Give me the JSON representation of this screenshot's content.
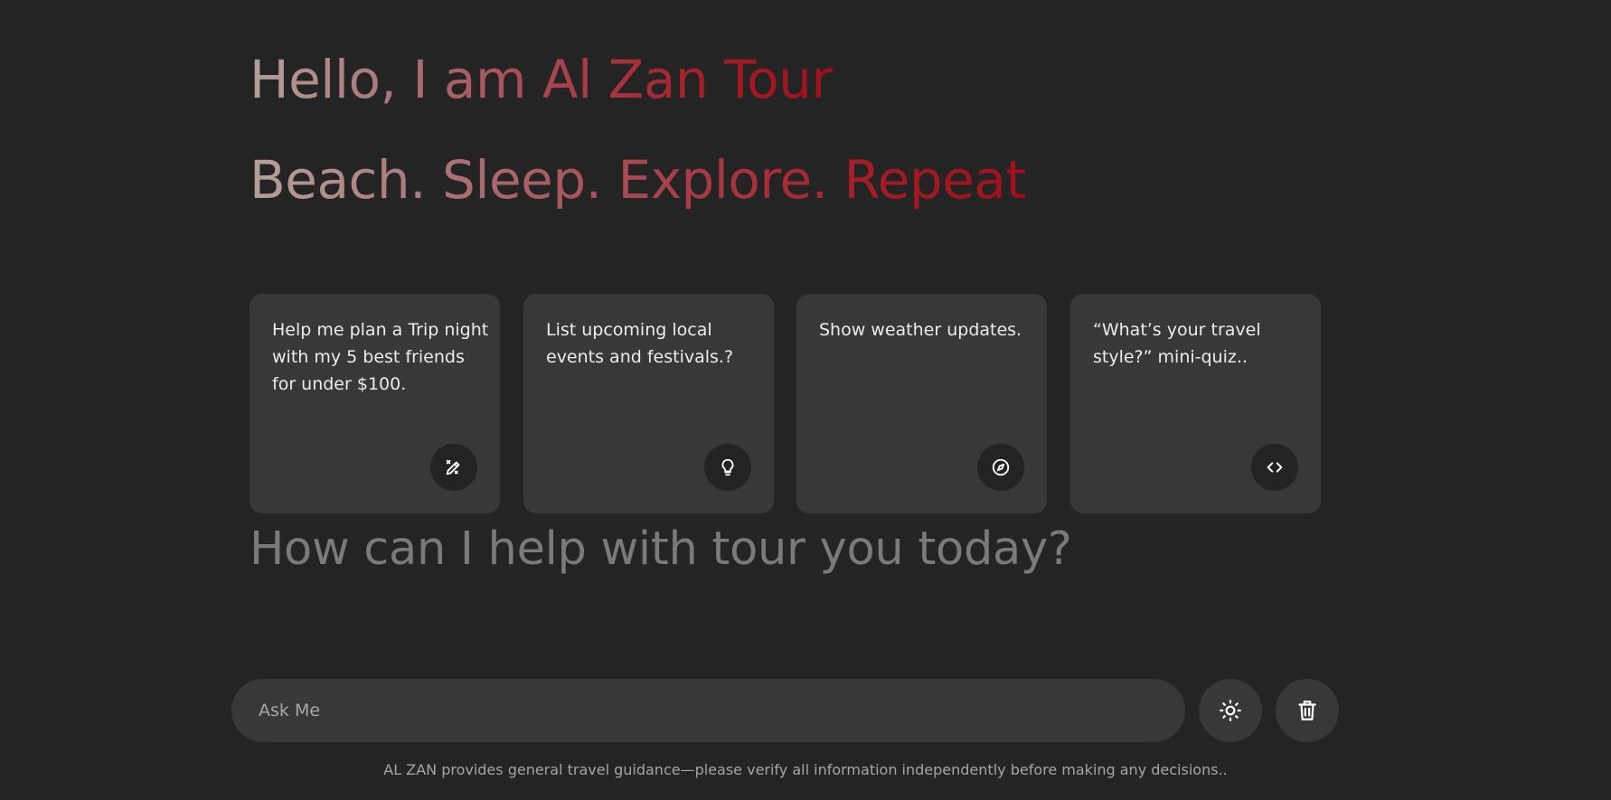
{
  "hero": {
    "greeting": "Hello, I am Al Zan Tour",
    "tagline": "Beach. Sleep. Explore. Repeat"
  },
  "suggestions": [
    {
      "text": "Help me plan a Trip night with my 5 best friends for under $100.",
      "icon": "pencil-sparkle-icon"
    },
    {
      "text": "List upcoming local events and festivals.?",
      "icon": "lightbulb-icon"
    },
    {
      "text": "Show weather updates.",
      "icon": "compass-icon"
    },
    {
      "text": "“What’s your travel style?” mini-quiz..",
      "icon": "code-icon"
    }
  ],
  "prompt_heading": "How can I help with tour you today?",
  "chat_input": {
    "placeholder": "Ask Me",
    "value": ""
  },
  "actions": {
    "theme_toggle_icon": "sun-icon",
    "delete_icon": "trash-icon"
  },
  "footer": {
    "disclaimer": "AL ZAN provides general travel guidance—please verify all information independently before making any decisions.."
  },
  "colors": {
    "background": "#242424",
    "card": "#383838",
    "accent_red": "#a0101c",
    "gradient_start": "#b3a09a",
    "heading_gray": "#7a7a7a"
  }
}
